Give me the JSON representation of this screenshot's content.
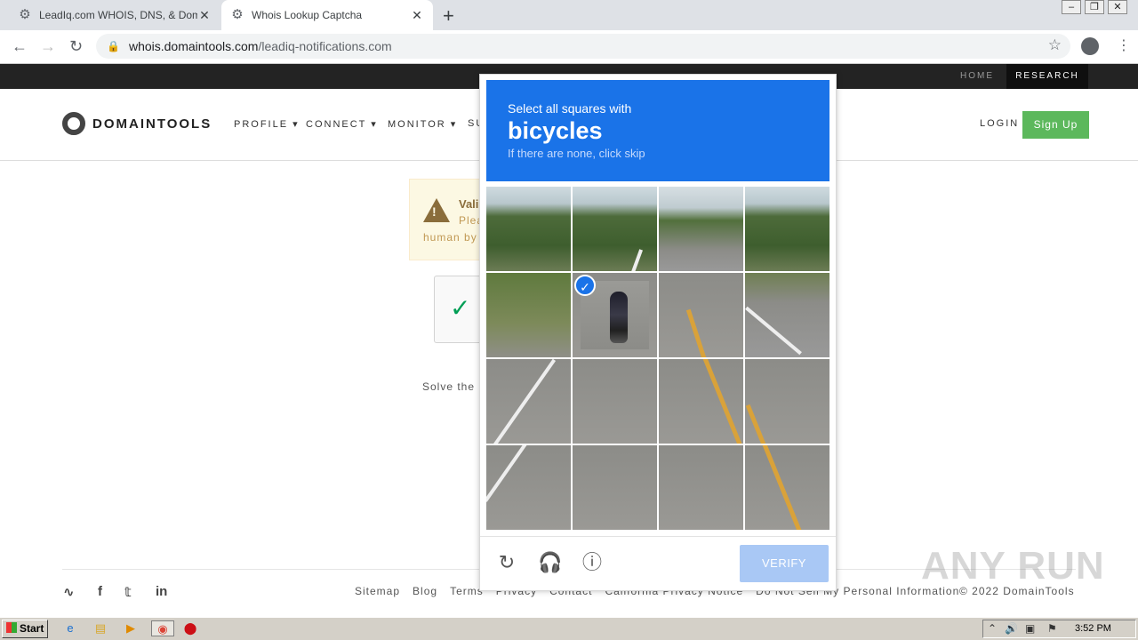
{
  "browser": {
    "tabs": [
      {
        "title": "LeadIq.com WHOIS, DNS, & Domain",
        "active": false
      },
      {
        "title": "Whois Lookup Captcha",
        "active": true
      }
    ],
    "url_host": "whois.domaintools.com",
    "url_path": "/leadiq-notifications.com"
  },
  "site": {
    "topbar": {
      "home": "HOME",
      "research": "RESEARCH"
    },
    "logo_text": "DOMAINTOOLS",
    "nav": [
      "PROFILE",
      "CONNECT",
      "MONITOR",
      "SU"
    ],
    "login": "LOGIN",
    "signup": "Sign Up",
    "alert": {
      "title": "Vali",
      "line2": "Plea",
      "line3": "human by"
    },
    "solve_text": "Solve the",
    "footer_links": [
      "Sitemap",
      "Blog",
      "Terms",
      "Privacy",
      "Contact",
      "California Privacy Notice",
      "Do Not Sell My Personal Information"
    ],
    "copyright": "© 2022 DomainTools"
  },
  "captcha": {
    "prompt_line1": "Select all squares with",
    "prompt_keyword": "bicycles",
    "prompt_line3": "If there are none, click skip",
    "verify": "VERIFY",
    "selected_tiles": [
      5
    ]
  },
  "watermark": "ANY RUN",
  "taskbar": {
    "start": "Start",
    "clock": "3:52 PM"
  },
  "colors": {
    "captcha_blue": "#1a73e8",
    "signup_green": "#5cb85c",
    "verify_disabled": "#a9c8f5"
  }
}
